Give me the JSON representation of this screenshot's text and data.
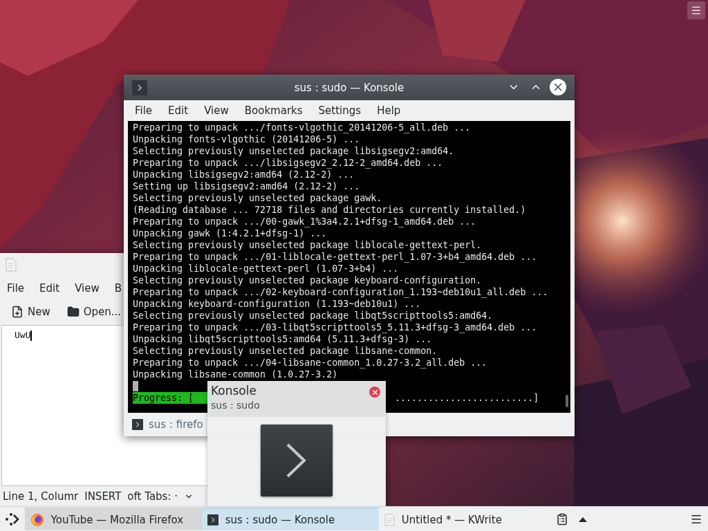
{
  "kwrite": {
    "menu": [
      "File",
      "Edit",
      "View",
      "B"
    ],
    "toolbar": [
      {
        "label": "New",
        "kind": "new"
      },
      {
        "label": "Open...",
        "kind": "open"
      }
    ],
    "text": "UwU",
    "status": [
      "Line 1, Columr",
      "INSERT",
      "oft Tabs: ·"
    ]
  },
  "konsole": {
    "title": "sus : sudo — Konsole",
    "menu": [
      "File",
      "Edit",
      "View",
      "Bookmarks",
      "Settings",
      "Help"
    ],
    "lines": [
      "Preparing to unpack .../fonts-vlgothic_20141206-5_all.deb ...",
      "Unpacking fonts-vlgothic (20141206-5) ...",
      "Selecting previously unselected package libsigsegv2:amd64.",
      "Preparing to unpack .../libsigsegv2_2.12-2_amd64.deb ...",
      "Unpacking libsigsegv2:amd64 (2.12-2) ...",
      "Setting up libsigsegv2:amd64 (2.12-2) ...",
      "Selecting previously unselected package gawk.",
      "(Reading database ... 72718 files and directories currently installed.)",
      "Preparing to unpack .../00-gawk_1%3a4.2.1+dfsg-1_amd64.deb ...",
      "Unpacking gawk (1:4.2.1+dfsg-1) ...",
      "Selecting previously unselected package liblocale-gettext-perl.",
      "Preparing to unpack .../01-liblocale-gettext-perl_1.07-3+b4_amd64.deb ...",
      "Unpacking liblocale-gettext-perl (1.07-3+b4) ...",
      "Selecting previously unselected package keyboard-configuration.",
      "Preparing to unpack .../02-keyboard-configuration_1.193~deb10u1_all.deb ...",
      "Unpacking keyboard-configuration (1.193~deb10u1) ...",
      "Selecting previously unselected package libqt5scripttools5:amd64.",
      "Preparing to unpack .../03-libqt5scripttools5_5.11.3+dfsg-3_amd64.deb ...",
      "Unpacking libqt5scripttools5:amd64 (5.11.3+dfsg-3) ...",
      "Selecting previously unselected package libsane-common.",
      "Preparing to unpack .../04-libsane-common_1.0.27-3.2_all.deb ...",
      "Unpacking libsane-common (1.0.27-3.2)"
    ],
    "progress": {
      "label": "Progress: [",
      "tail": ".........................]"
    },
    "tabs": [
      {
        "label": "sus : firefo",
        "selected": false
      }
    ]
  },
  "tooltip": {
    "title": "Konsole",
    "subtitle": "sus : sudo"
  },
  "taskbar": {
    "tasks": [
      {
        "label": "YouTube — Mozilla Firefox",
        "kind": "firefox",
        "selected": false,
        "highlighted": true
      },
      {
        "label": "sus : sudo — Konsole",
        "kind": "konsole",
        "selected": true,
        "highlighted": false
      },
      {
        "label": "Untitled * — KWrite",
        "kind": "kwrite",
        "selected": false,
        "highlighted": false
      }
    ]
  }
}
